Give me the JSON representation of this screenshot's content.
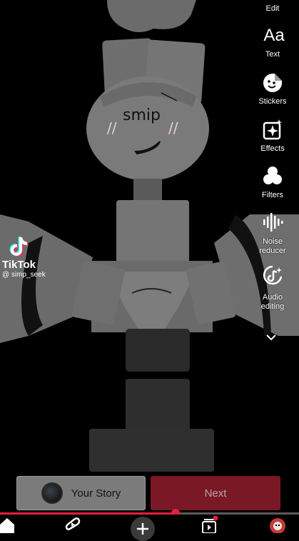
{
  "header": {
    "edit_label": "Edit"
  },
  "avatar_face": {
    "text": "smip",
    "blush_left": "//",
    "blush_right": "//"
  },
  "rail": [
    {
      "name": "text-tool",
      "glyph": "Aa",
      "label": "Text",
      "icon": "text-icon"
    },
    {
      "name": "stickers-tool",
      "label": "Stickers",
      "icon": "sticker-icon"
    },
    {
      "name": "effects-tool",
      "label": "Effects",
      "icon": "effects-icon"
    },
    {
      "name": "filters-tool",
      "label": "Filters",
      "icon": "filters-icon"
    },
    {
      "name": "noise-reducer-tool",
      "label": "Noise reducer",
      "label_line1": "Noise",
      "label_line2": "reducer",
      "icon": "waveform-icon"
    },
    {
      "name": "audio-editing-tool",
      "label": "Audio editing",
      "label_line1": "Audio",
      "label_line2": "editing",
      "icon": "audio-edit-icon"
    }
  ],
  "more_icon": "chevron-down-icon",
  "watermark": {
    "brand": "TikTok",
    "username": "@ simp_seek",
    "icon": "tiktok-logo-icon"
  },
  "actions": {
    "your_story_label": "Your Story",
    "next_label": "Next"
  },
  "progress": {
    "value": 0.587
  },
  "colors": {
    "accent": "#e0213d",
    "next_bg": "#7a1826",
    "story_bg": "#7b7b7b"
  },
  "navbar": [
    "home-icon",
    "shorts-icon",
    "create-icon",
    "subscriptions-icon",
    "profile-avatar-icon"
  ]
}
